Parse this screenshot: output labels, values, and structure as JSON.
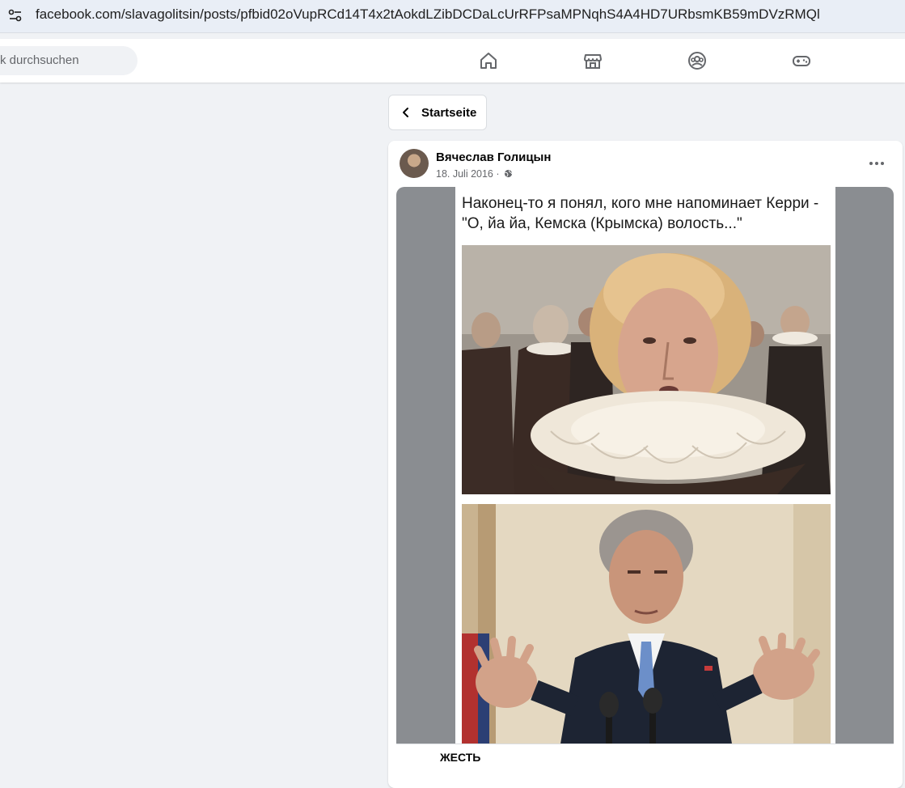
{
  "browser": {
    "url": "facebook.com/slavagolitsin/posts/pfbid02oVupRCd14T4x2tAokdLZibDCDaLcUrRFPsaMPNqhS4A4HD7URbsmKB59mDVzRMQl",
    "site_info_icon": "tune-icon"
  },
  "fb_header": {
    "search_placeholder": "k durchsuchen",
    "nav_icons": [
      "home-icon",
      "marketplace-icon",
      "groups-icon",
      "gaming-icon"
    ]
  },
  "back_button": {
    "label": "Startseite"
  },
  "post": {
    "author": "Вячеслав Голицын",
    "date": "18. Juli 2016 ·",
    "privacy_icon": "globe-icon",
    "menu_icon": "more-icon",
    "image_caption": "Наконец-то я понял, кого мне напоминает Керри - \"О, йа йа, Кемска (Крымска) волость...\"",
    "shared_source": "ЖЕСТЬ"
  },
  "colors": {
    "page_bg": "#f0f2f5",
    "card_bg": "#ffffff",
    "secondary_text": "#65676b",
    "media_bg": "#8a8d91"
  }
}
